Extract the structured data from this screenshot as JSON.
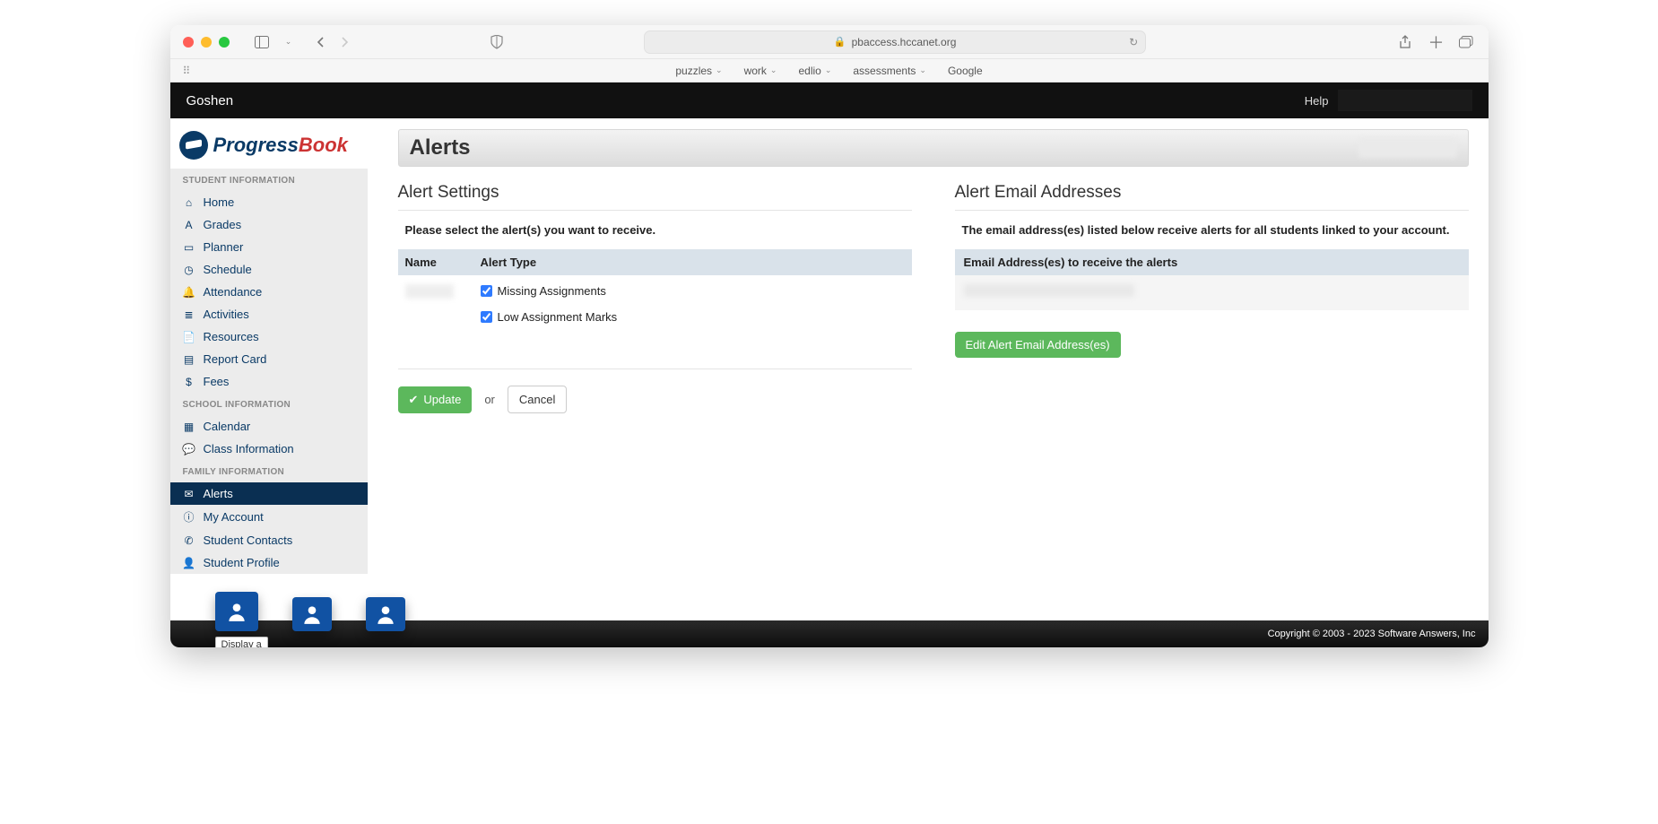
{
  "browser": {
    "url": "pbaccess.hccanet.org",
    "bookmarks": [
      "puzzles",
      "work",
      "edlio",
      "assessments",
      "Google"
    ]
  },
  "topbar": {
    "district": "Goshen",
    "help": "Help"
  },
  "logo": {
    "part1": "Progress",
    "part2": "Book"
  },
  "sidebar": {
    "sections": [
      {
        "title": "STUDENT INFORMATION",
        "items": [
          {
            "label": "Home",
            "icon": "⌂"
          },
          {
            "label": "Grades",
            "icon": "A"
          },
          {
            "label": "Planner",
            "icon": "▭"
          },
          {
            "label": "Schedule",
            "icon": "◷"
          },
          {
            "label": "Attendance",
            "icon": "🔔"
          },
          {
            "label": "Activities",
            "icon": "≣"
          },
          {
            "label": "Resources",
            "icon": "📄"
          },
          {
            "label": "Report Card",
            "icon": "▤"
          },
          {
            "label": "Fees",
            "icon": "$"
          }
        ]
      },
      {
        "title": "SCHOOL INFORMATION",
        "items": [
          {
            "label": "Calendar",
            "icon": "▦"
          },
          {
            "label": "Class Information",
            "icon": "💬"
          }
        ]
      },
      {
        "title": "FAMILY INFORMATION",
        "items": [
          {
            "label": "Alerts",
            "icon": "✉",
            "active": true
          },
          {
            "label": "My Account",
            "icon": "ⓘ"
          },
          {
            "label": "Student Contacts",
            "icon": "✆"
          },
          {
            "label": "Student Profile",
            "icon": "👤"
          }
        ]
      }
    ]
  },
  "page": {
    "title": "Alerts"
  },
  "alertSettings": {
    "heading": "Alert Settings",
    "instruction": "Please select the alert(s) you want to receive.",
    "cols": {
      "name": "Name",
      "type": "Alert Type"
    },
    "types": [
      {
        "label": "Missing Assignments",
        "checked": true
      },
      {
        "label": "Low Assignment Marks",
        "checked": true
      }
    ],
    "update": "Update",
    "or": "or",
    "cancel": "Cancel"
  },
  "alertEmails": {
    "heading": "Alert Email Addresses",
    "instruction": "The email address(es) listed below receive alerts for all students linked to your account.",
    "colhdr": "Email Address(es) to receive the alerts",
    "edit": "Edit Alert Email Address(es)"
  },
  "footer": {
    "copyright": "Copyright © 2003 - 2023 Software Answers, Inc"
  },
  "tooltip": "Display a"
}
